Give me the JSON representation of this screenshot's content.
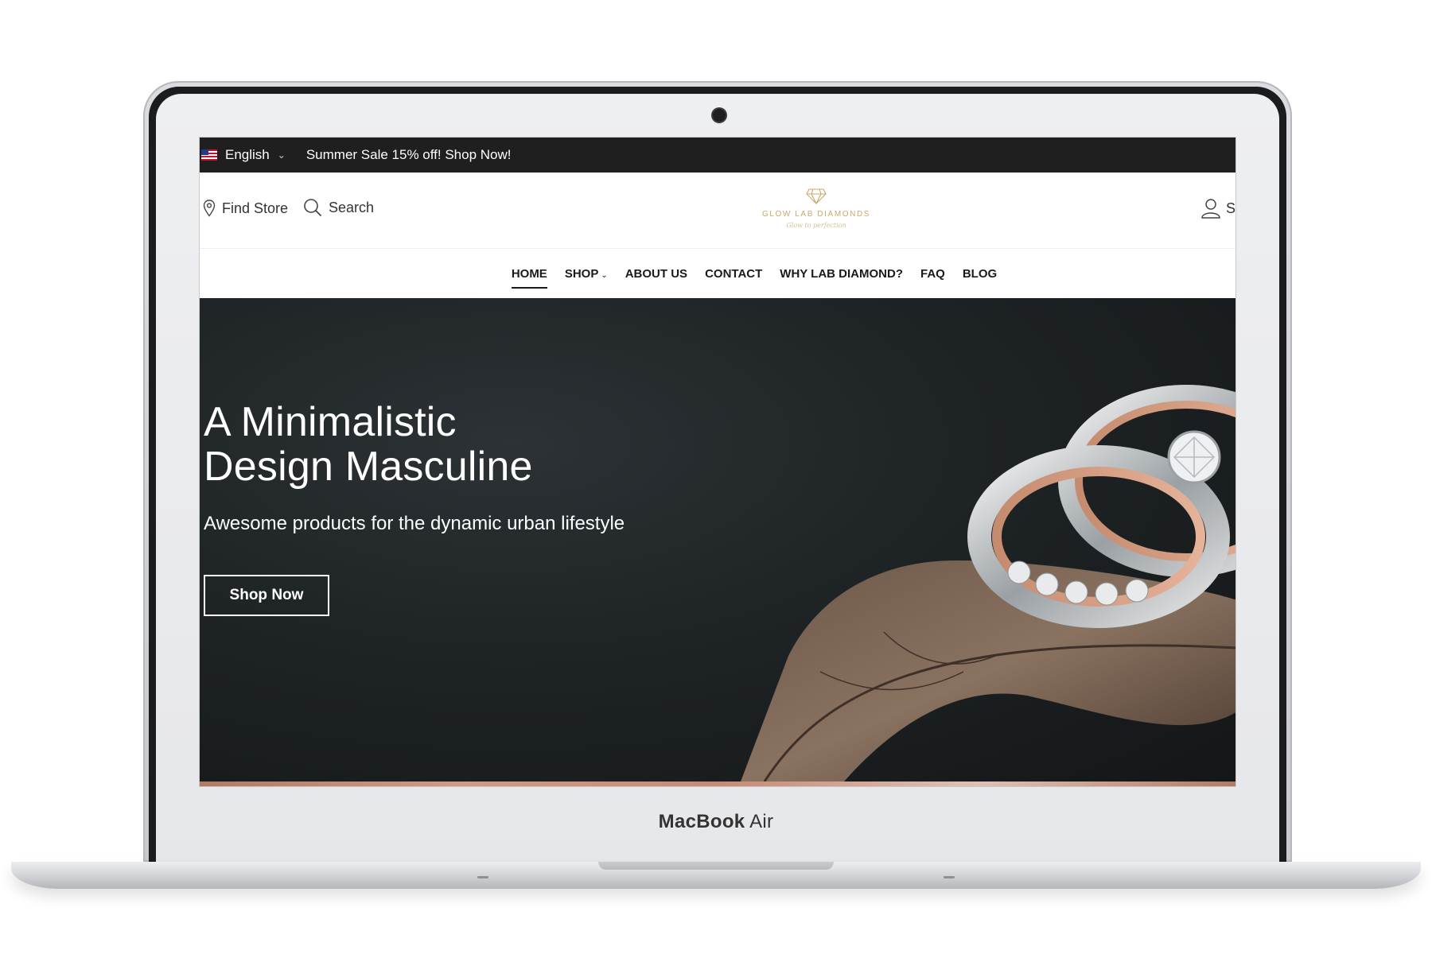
{
  "device": {
    "brand_bold": "MacBook",
    "brand_model": "Air"
  },
  "topbar": {
    "language": "English",
    "promo": "Summer Sale 15% off! Shop Now!"
  },
  "header": {
    "find_store": "Find Store",
    "search": "Search",
    "logo_text": "GLOW LAB DIAMONDS",
    "logo_tagline": "Glow to perfection",
    "account_label": "S"
  },
  "nav": {
    "items": [
      {
        "label": "HOME",
        "active": true
      },
      {
        "label": "SHOP",
        "has_dropdown": true
      },
      {
        "label": "ABOUT US"
      },
      {
        "label": "CONTACT"
      },
      {
        "label": "WHY LAB DIAMOND?"
      },
      {
        "label": "FAQ"
      },
      {
        "label": "BLOG"
      }
    ]
  },
  "hero": {
    "title_line1": "A Minimalistic",
    "title_line2": "Design Masculine",
    "subtitle": "Awesome products for the dynamic urban lifestyle",
    "cta": "Shop Now"
  },
  "colors": {
    "topbar_bg": "#1f1f1f",
    "logo_gold": "#c9a96e",
    "hero_bg": "#1e2325"
  }
}
